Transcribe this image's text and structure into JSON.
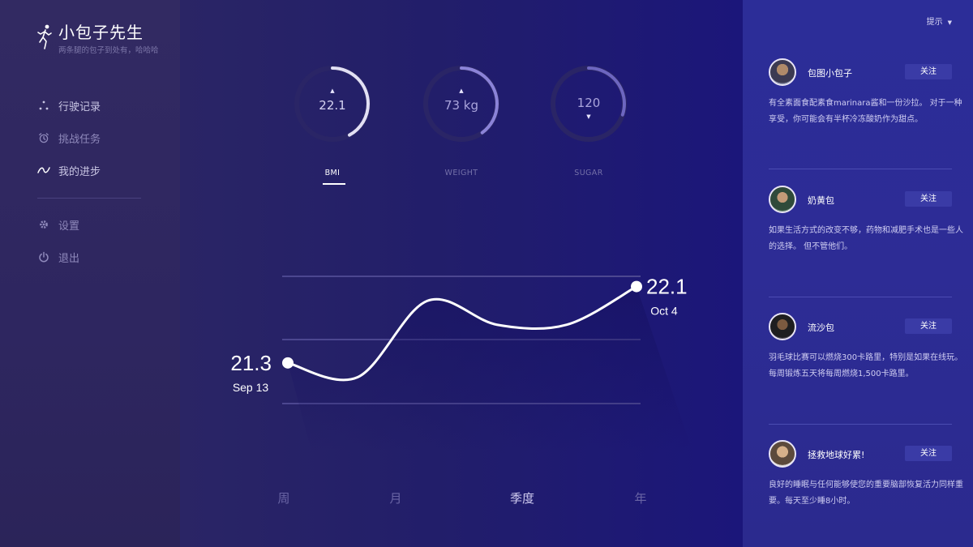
{
  "brand": {
    "title": "小包子先生",
    "tagline": "两条腿的包子到处有，哈哈哈"
  },
  "nav": {
    "items": [
      {
        "label": "行驶记录",
        "icon": "dots-icon"
      },
      {
        "label": "挑战任务",
        "icon": "alarm-clock-icon"
      },
      {
        "label": "我的进步",
        "icon": "trend-line-icon"
      }
    ],
    "secondary": [
      {
        "label": "设置",
        "icon": "gear-icon"
      },
      {
        "label": "退出",
        "icon": "power-icon"
      }
    ]
  },
  "metrics": {
    "gauges": [
      {
        "value": "22.1",
        "label": "BMI",
        "direction": "up",
        "progress": 0.42,
        "active": true
      },
      {
        "value": "73 kg",
        "label": "WEIGHT",
        "direction": "up",
        "progress": 0.4,
        "active": false
      },
      {
        "value": "120",
        "label": "SUGAR",
        "direction": "down",
        "progress": 0.3,
        "active": false
      }
    ]
  },
  "chart_data": {
    "type": "line",
    "x": [
      "Sep 13",
      "",
      "",
      "",
      "",
      "Oct 4"
    ],
    "values": [
      21.3,
      21.15,
      21.95,
      21.7,
      21.7,
      22.1
    ],
    "start": {
      "value": "21.3",
      "date": "Sep 13"
    },
    "end": {
      "value": "22.1",
      "date": "Oct 4"
    },
    "grid": true
  },
  "periods": [
    {
      "label": "周",
      "active": false
    },
    {
      "label": "月",
      "active": false
    },
    {
      "label": "季度",
      "active": true
    },
    {
      "label": "年",
      "active": false
    }
  ],
  "feed": {
    "hint": "提示",
    "follow_label": "关注",
    "posts": [
      {
        "user": "包图小包子",
        "text": "有全素面食配素食marinara酱和一份沙拉。 对于一种享受，你可能会有半杯冷冻酸奶作为甜点。"
      },
      {
        "user": "奶黄包",
        "text": "如果生活方式的改变不够，药物和减肥手术也是一些人的选择。 但不管他们。"
      },
      {
        "user": "流沙包",
        "text": "羽毛球比赛可以燃烧300卡路里，特别是如果在线玩。每周锻炼五天将每周燃烧1,500卡路里。"
      },
      {
        "user": "拯救地球好累!",
        "text": "良好的睡眠与任何能够使您的重要脑部恢复活力同样重要。每天至少睡8小时。"
      }
    ]
  }
}
